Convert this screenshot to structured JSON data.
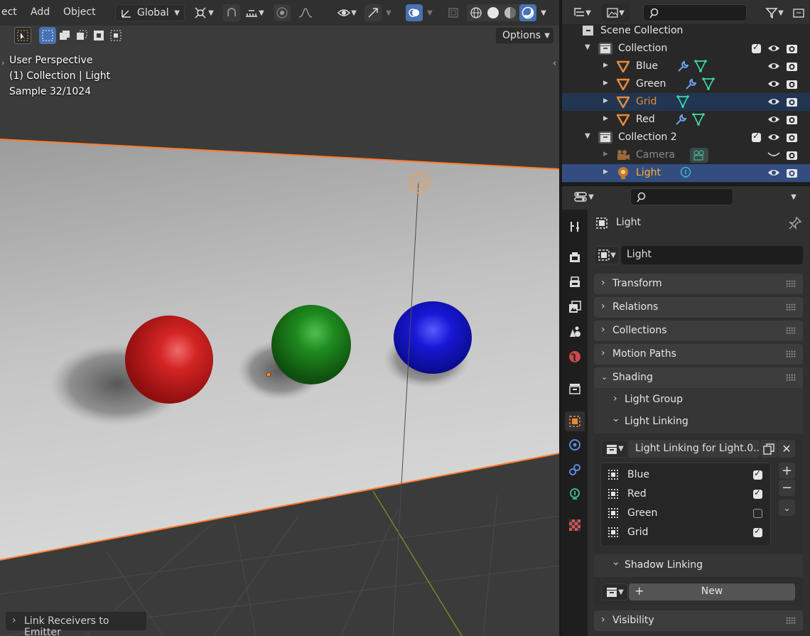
{
  "viewport_header": {
    "menu": [
      "ect",
      "Add",
      "Object"
    ],
    "transform_orientation": "Global",
    "options_label": "Options"
  },
  "viewport_overlay": {
    "view_name": "User Perspective",
    "active": "(1) Collection | Light",
    "samples": "Sample 32/1024"
  },
  "operator_panel": {
    "label": "Link Receivers to Emitter"
  },
  "outliner": {
    "search_placeholder": "",
    "scene_collection": "Scene Collection",
    "rows": [
      {
        "label": "Collection"
      },
      {
        "label": "Blue"
      },
      {
        "label": "Green"
      },
      {
        "label": "Grid"
      },
      {
        "label": "Red"
      },
      {
        "label": "Collection 2"
      },
      {
        "label": "Camera"
      },
      {
        "label": "Light"
      }
    ]
  },
  "properties": {
    "search_placeholder": "",
    "context_name": "Light",
    "object_name": "Light",
    "panels": {
      "transform": "Transform",
      "relations": "Relations",
      "collections": "Collections",
      "motion_paths": "Motion Paths",
      "shading": "Shading",
      "visibility": "Visibility"
    },
    "shading": {
      "light_group": "Light Group",
      "light_linking": "Light Linking",
      "light_linking_collection": "Light Linking for Light.0...",
      "receivers": [
        {
          "name": "Blue",
          "checked": true
        },
        {
          "name": "Red",
          "checked": true
        },
        {
          "name": "Green",
          "checked": false
        },
        {
          "name": "Grid",
          "checked": true
        }
      ],
      "shadow_linking": "Shadow Linking",
      "new_button": "New"
    }
  },
  "colors": {
    "selection": "#334d80",
    "active_text": "#ffaf29",
    "object_orange": "#e58a3a",
    "modifier_blue": "#6c9ef0",
    "mesh_green": "#3fd7a5",
    "light_teal": "#42b3c5"
  }
}
